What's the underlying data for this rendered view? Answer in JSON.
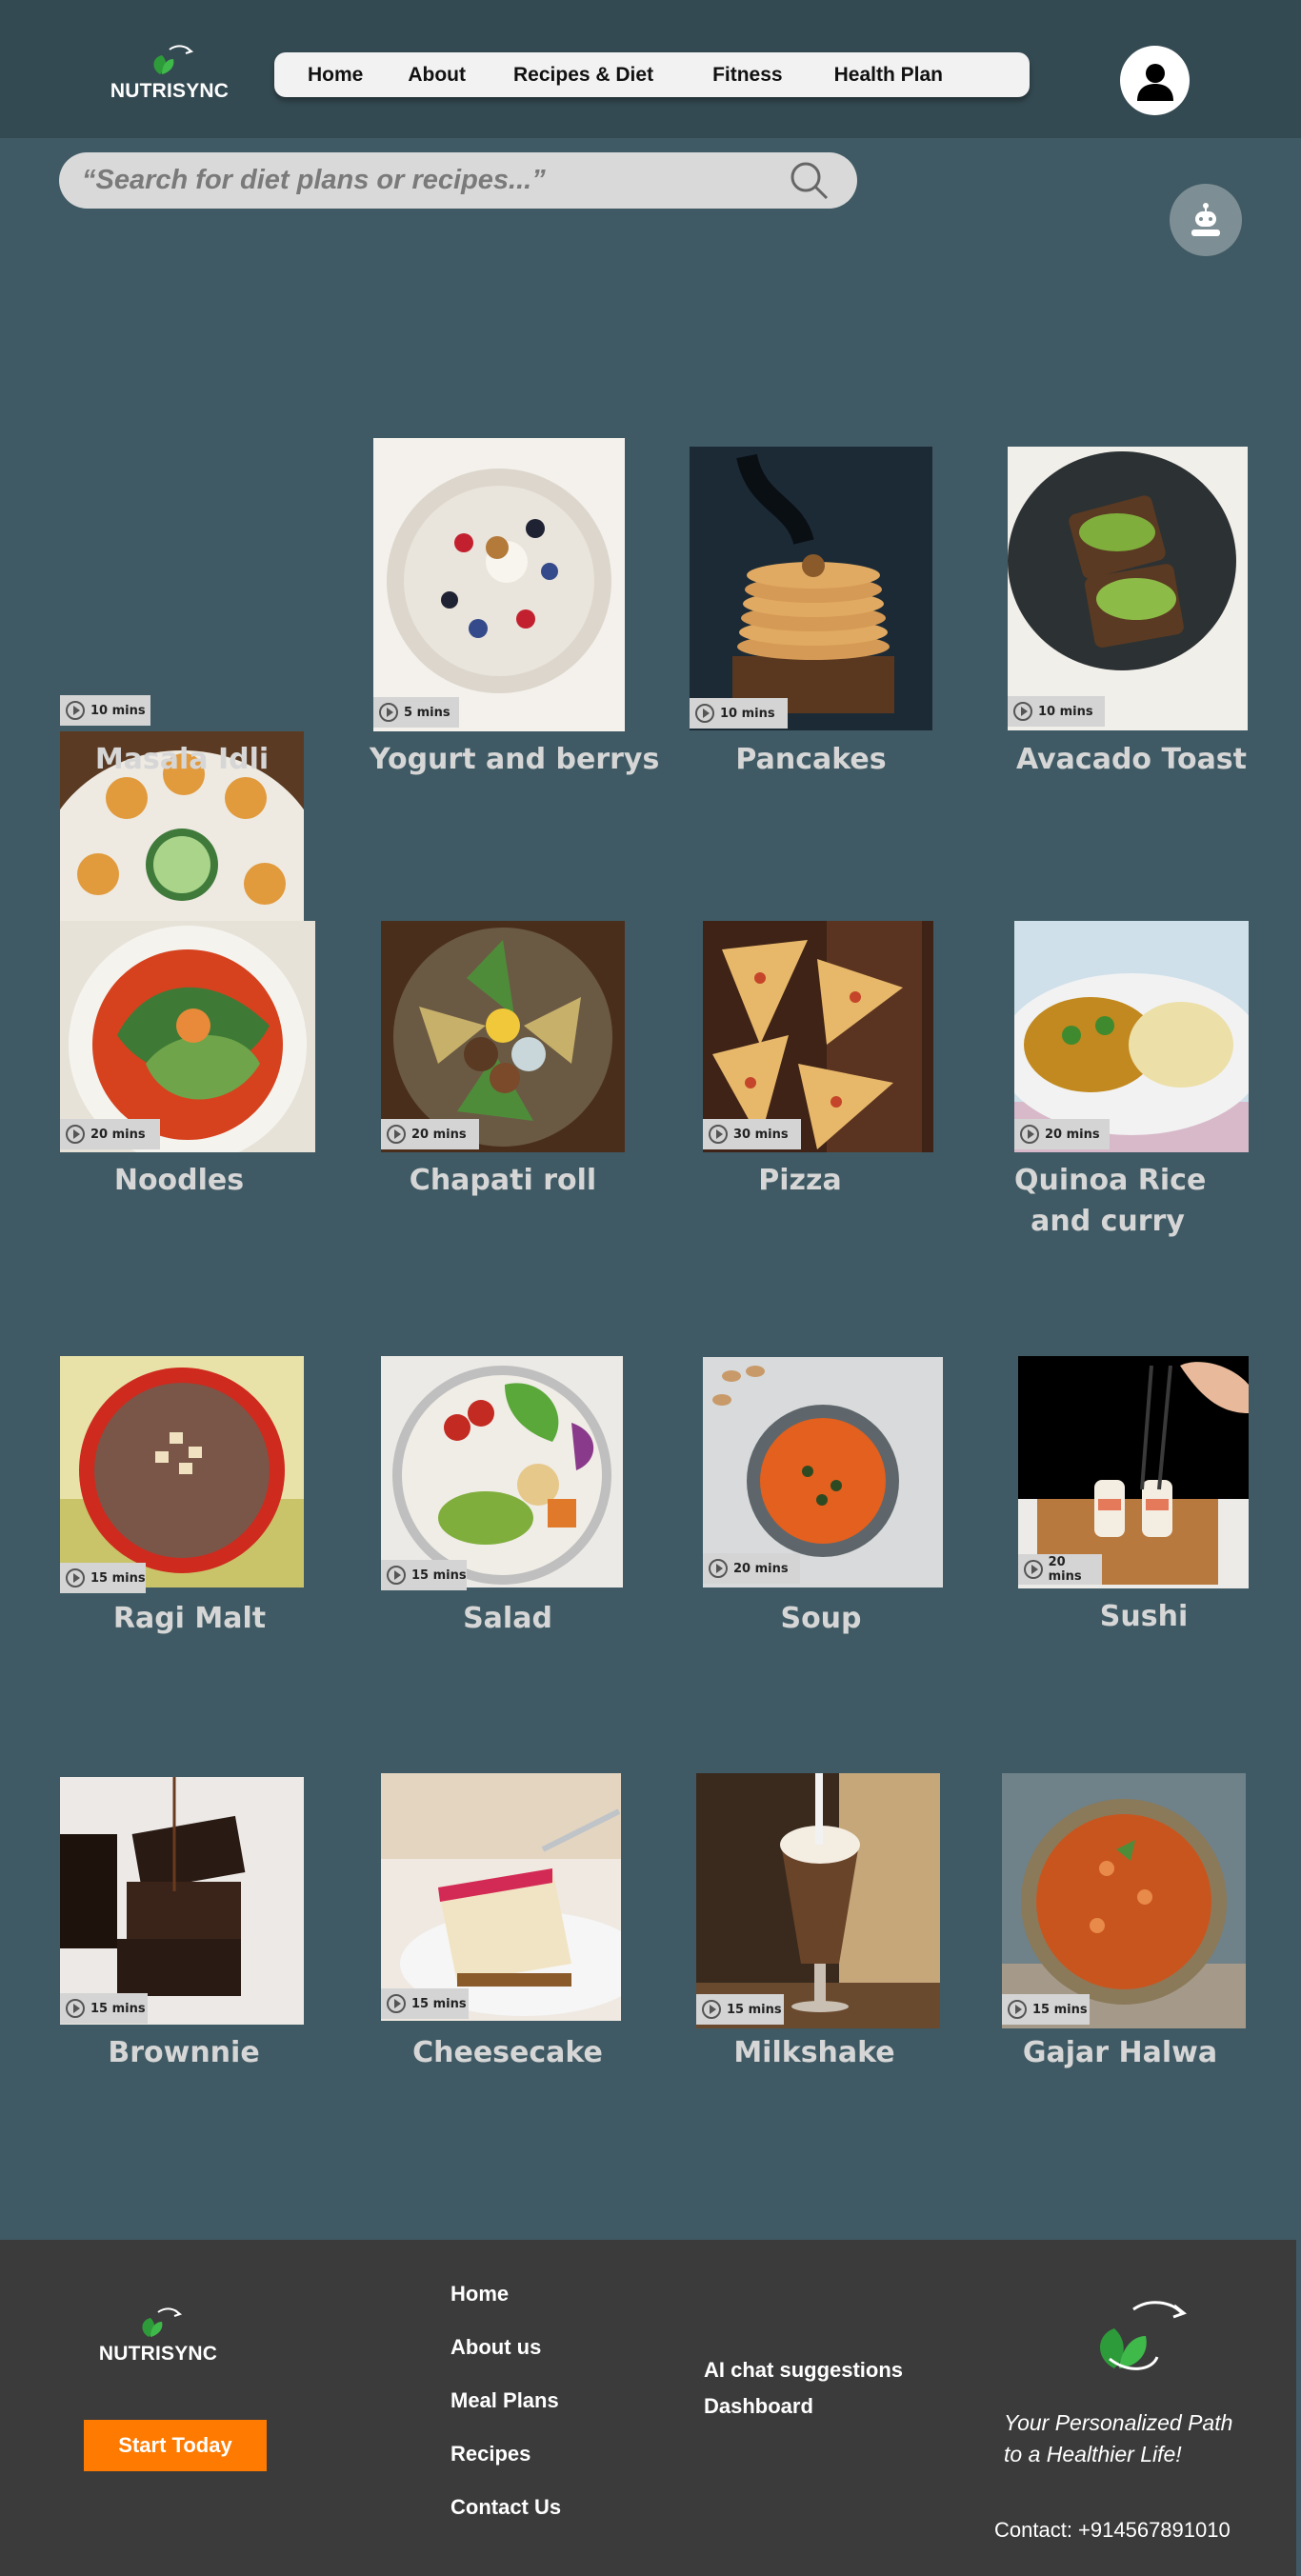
{
  "brand": {
    "name": "NUTRISYNC"
  },
  "nav": [
    {
      "label": "Home"
    },
    {
      "label": "About"
    },
    {
      "label": "Recipes & Diet"
    },
    {
      "label": "Fitness"
    },
    {
      "label": "Health Plan"
    }
  ],
  "search": {
    "placeholder": "“Search for diet plans or recipes...”"
  },
  "icons": {
    "search": "search-icon",
    "user": "user-icon",
    "bot": "chatbot-icon",
    "play": "play-icon"
  },
  "colors": {
    "page_bg": "#3f5a64",
    "header_bg": "#344a52",
    "footer_bg": "#3b3b3b",
    "accent": "#ff7a00"
  },
  "recipes": [
    {
      "title": "Masala Idli",
      "time": "10 mins"
    },
    {
      "title": "Yogurt and berrys",
      "time": "5 mins"
    },
    {
      "title": "Pancakes",
      "time": "10 mins"
    },
    {
      "title": "Avacado Toast",
      "time": "10 mins"
    },
    {
      "title": "Noodles",
      "time": "20 mins"
    },
    {
      "title": "Chapati roll",
      "time": "20 mins"
    },
    {
      "title": "Pizza",
      "time": "30 mins"
    },
    {
      "title": "Quinoa Rice",
      "title2": "and curry",
      "time": "20 mins"
    },
    {
      "title": "Ragi Malt",
      "time": "15 mins"
    },
    {
      "title": "Salad",
      "time": "15 mins"
    },
    {
      "title": "Soup",
      "time": "20 mins"
    },
    {
      "title": "Sushi",
      "time": "20 mins"
    },
    {
      "title": "Brownnie",
      "time": "15 mins"
    },
    {
      "title": "Cheesecake",
      "time": "15 mins"
    },
    {
      "title": "Milkshake",
      "time": "15 mins"
    },
    {
      "title": "Gajar Halwa",
      "time": "15 mins"
    }
  ],
  "footer": {
    "brand": "NUTRISYNC",
    "cta": "Start Today",
    "links": [
      "Home",
      "About us",
      "Meal Plans",
      "Recipes",
      "Contact Us"
    ],
    "links2": [
      "AI chat suggestions",
      "Dashboard"
    ],
    "tagline1": "Your Personalized Path",
    "tagline2": "to a Healthier Life!",
    "contact": "Contact: +914567891010"
  }
}
